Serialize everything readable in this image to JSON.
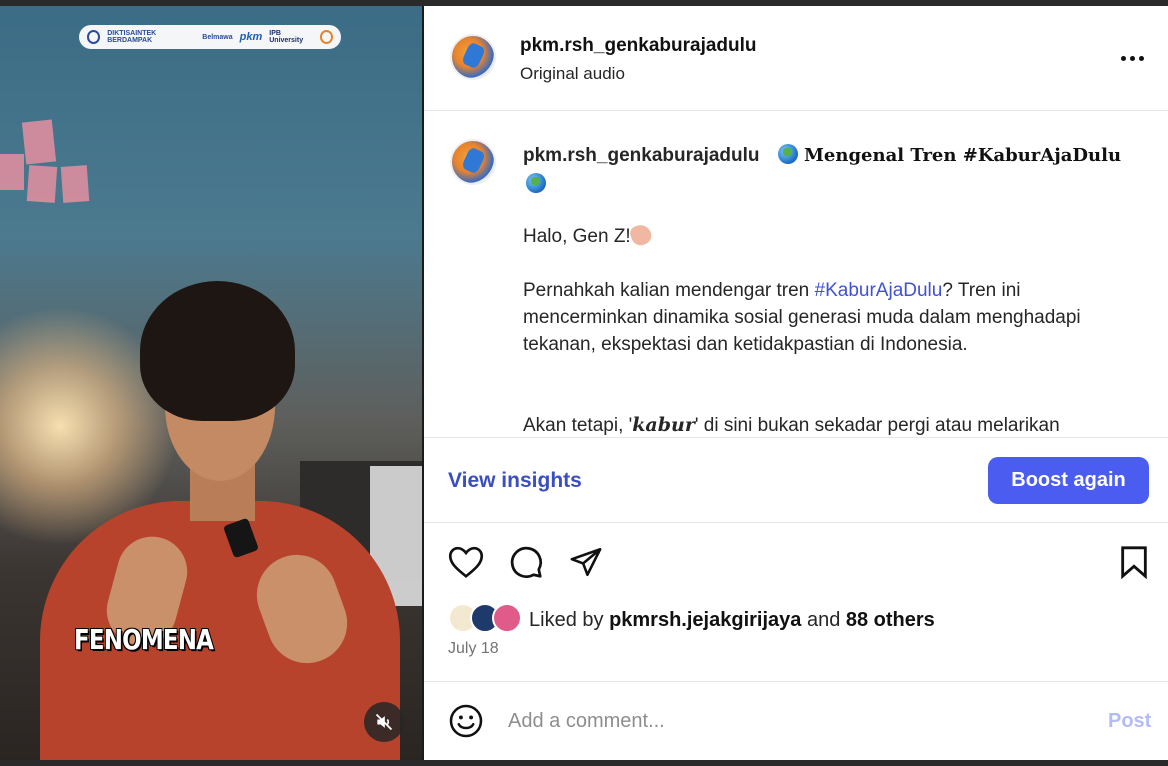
{
  "video": {
    "logo_strip": {
      "items": [
        "DIKTISAINTEK BERDAMPAK",
        "Belmawa",
        "pkm",
        "IPB University"
      ]
    },
    "caption": "FENOMENA",
    "mute_icon": "speaker-muted-icon"
  },
  "post": {
    "author": "pkm.rsh_genkaburajadulu",
    "audio": "Original audio",
    "more_icon": "more-horizontal-icon",
    "caption": {
      "author": "pkm.rsh_genkaburajadulu",
      "title": "Mengenal Tren #KaburAjaDulu",
      "greeting": "Halo, Gen Z!",
      "para1_before": "Pernahkah kalian mendengar tren ",
      "para1_hashtag": "#KaburAjaDulu",
      "para1_after": "? Tren ini mencerminkan dinamika sosial generasi muda dalam menghadapi tekanan, ekspektasi dan ketidakpastian di Indonesia.",
      "para2_before": "Akan tetapi, '",
      "para2_emph": "kabur",
      "para2_after": "' di sini bukan sekadar pergi atau melarikan"
    },
    "actions": {
      "view_insights": "View insights",
      "boost_again": "Boost again",
      "like_icon": "heart-icon",
      "comment_icon": "comment-icon",
      "share_icon": "send-icon",
      "save_icon": "bookmark-icon"
    },
    "likes": {
      "prefix": "Liked by ",
      "user": "pkmrsh.jejakgirijaya",
      "middle": " and ",
      "others": "88 others"
    },
    "date": "July 18",
    "comment": {
      "placeholder": "Add a comment...",
      "post_label": "Post",
      "emoji_icon": "smiley-icon"
    }
  },
  "colors": {
    "accent": "#4a5df0",
    "link": "#3a4ec0",
    "hashtag": "#4050d8",
    "post_disabled": "#b3bcf5"
  }
}
